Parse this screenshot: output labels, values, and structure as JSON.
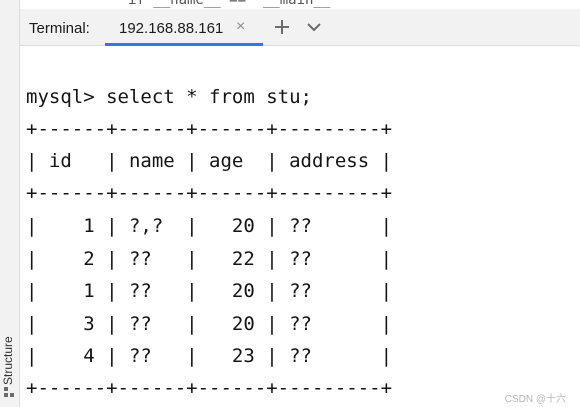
{
  "header": {
    "top_crumb": "if __name__ == '__main__'",
    "tool_window_title": "Terminal:",
    "tab_label": "192.168.88.161",
    "close_glyph": "×",
    "add_icon": "plus-icon",
    "menu_icon": "chevron-down-icon"
  },
  "sidebar": {
    "structure_label": "Structure",
    "structure_icon": "structure-icon"
  },
  "terminal": {
    "lines": [
      "mysql> select * from stu;",
      "+------+------+------+---------+",
      "| id   | name | age  | address |",
      "+------+------+------+---------+",
      "|    1 | ?,?  |   20 | ??      |",
      "|    2 | ??   |   22 | ??      |",
      "|    1 | ??   |   20 | ??      |",
      "|    3 | ??   |   20 | ??      |",
      "|    4 | ??   |   23 | ??      |",
      "+------+------+------+---------+"
    ]
  },
  "watermark": "CSDN @十六"
}
